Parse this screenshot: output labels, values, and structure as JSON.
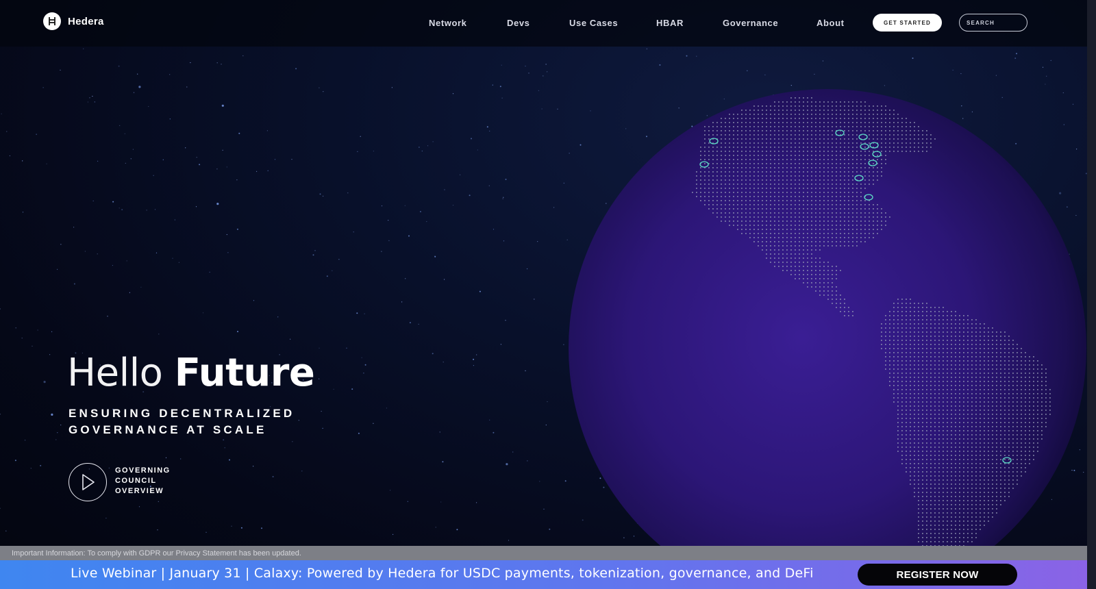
{
  "brand": {
    "name": "Hedera",
    "logo_letter": "H"
  },
  "nav": {
    "items": [
      {
        "label": "Network"
      },
      {
        "label": "Devs"
      },
      {
        "label": "Use Cases"
      },
      {
        "label": "HBAR"
      },
      {
        "label": "Governance"
      },
      {
        "label": "About"
      }
    ],
    "get_started_label": "GET STARTED",
    "search_placeholder": "SEARCH"
  },
  "hero": {
    "title_light": "Hello",
    "title_bold": "Future",
    "subtitle_line1": "ENSURING DECENTRALIZED",
    "subtitle_line2": "GOVERNANCE AT SCALE",
    "video_label_line1": "GOVERNING",
    "video_label_line2": "COUNCIL",
    "video_label_line3": "OVERVIEW"
  },
  "gdpr": {
    "text": "Important Information: To comply with GDPR our Privacy Statement has been updated."
  },
  "banner": {
    "text": "Live Webinar | January 31 | Calaxy: Powered by Hedera for USDC payments, tokenization, governance, and DeFi",
    "cta_label": "REGISTER NOW"
  },
  "colors": {
    "banner_start": "#3f86f0",
    "banner_end": "#8a63e6",
    "globe": "#2a1670",
    "marker": "#5ee0c8"
  },
  "icons": [
    "hedera-logo-icon",
    "play-icon"
  ]
}
